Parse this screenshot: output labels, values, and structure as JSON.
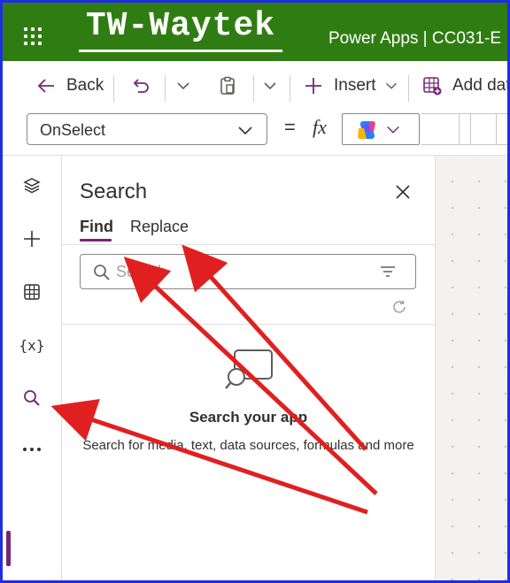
{
  "header": {
    "brand": "TW-Waytek",
    "app_title": "Power Apps  |  CC031-E"
  },
  "commandbar": {
    "back_label": "Back",
    "insert_label": "Insert",
    "add_data_label": "Add data"
  },
  "formulabar": {
    "property": "OnSelect",
    "equals": "=",
    "fx": "fx"
  },
  "search_pane": {
    "title": "Search",
    "tabs": [
      {
        "label": "Find",
        "active": true
      },
      {
        "label": "Replace",
        "active": false
      }
    ],
    "search_placeholder": "Search",
    "empty_title": "Search your app",
    "empty_description": "Search for media, text, data sources, formulas and more"
  },
  "rail": {
    "variables_label": "{x}"
  },
  "colors": {
    "topbar": "#2f7d12",
    "accent": "#742774",
    "annotation": "#e02020",
    "frame": "#1f2de0"
  }
}
